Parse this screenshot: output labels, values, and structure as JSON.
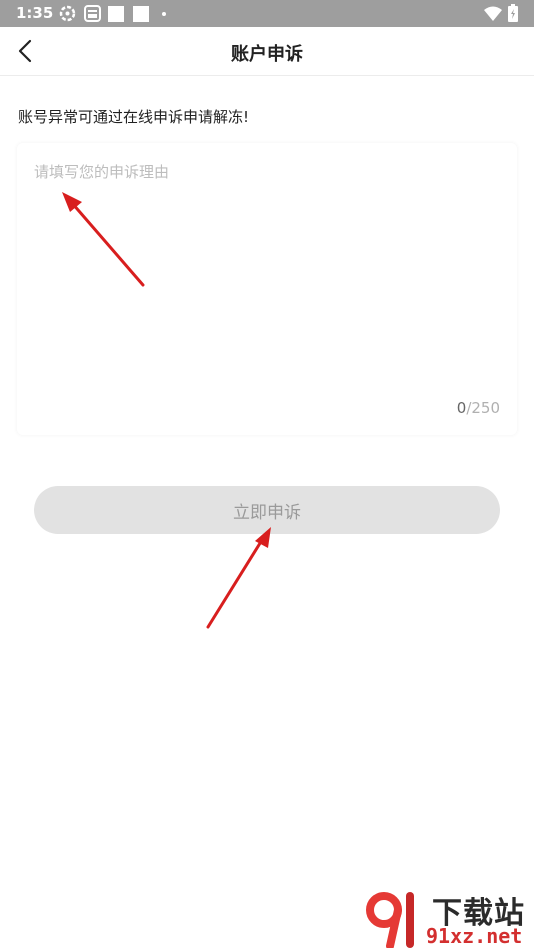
{
  "status_bar": {
    "time": "1:35",
    "icons": [
      "gear-icon",
      "sim-card-icon",
      "notification-square-icon",
      "notification-square-icon",
      "dot-icon",
      "wifi-icon",
      "battery-icon"
    ]
  },
  "nav": {
    "back_icon": "chevron-left-icon",
    "title": "账户申诉"
  },
  "form": {
    "hint": "账号异常可通过在线申诉申请解冻!",
    "placeholder": "请填写您的申诉理由",
    "value": "",
    "counter_current": "0",
    "counter_max": "/250",
    "submit_label": "立即申诉"
  },
  "colors": {
    "status_bar_bg": "#9e9e9e",
    "button_bg": "#e2e2e2",
    "button_text": "#9a9a9a",
    "placeholder": "#bdbdbd",
    "annotation_arrow": "#d81e1e"
  },
  "watermark": {
    "title": "下载站",
    "url": "91xz.net"
  }
}
